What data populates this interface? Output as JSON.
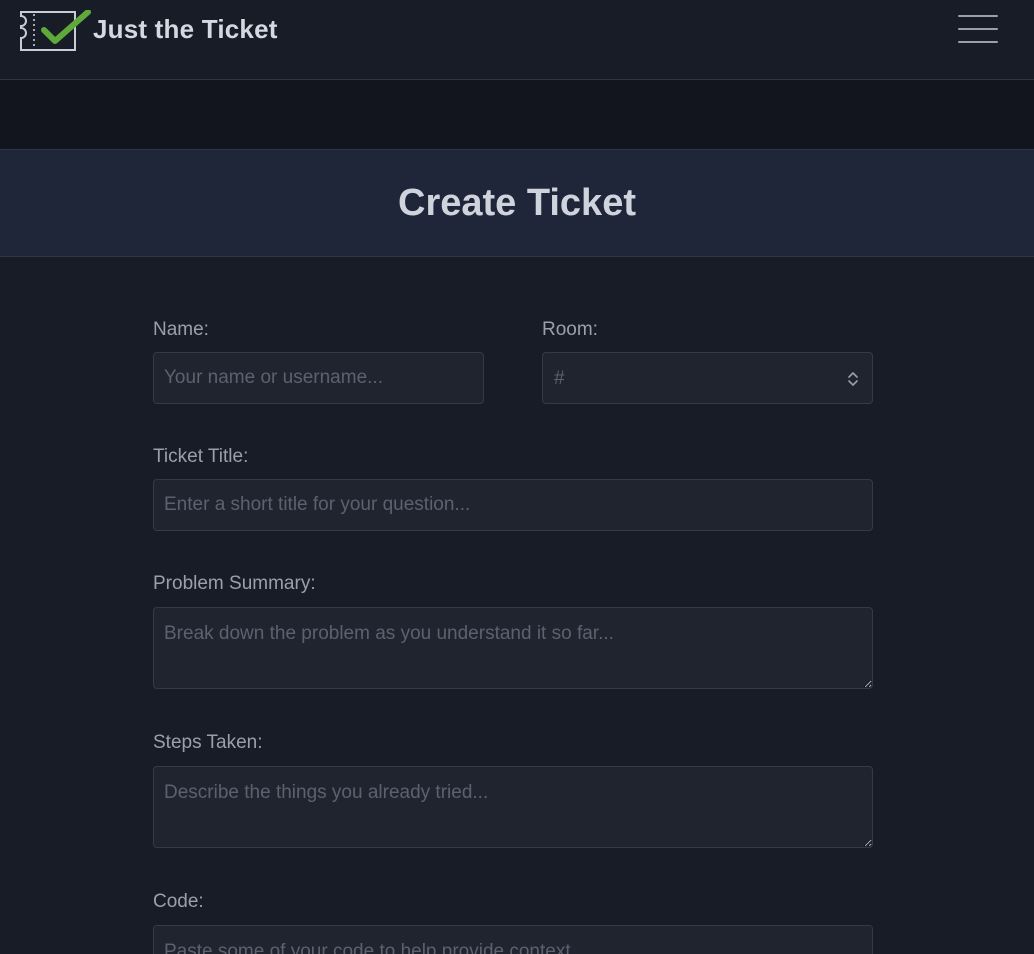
{
  "app": {
    "brand_name": "Just the Ticket",
    "accent": "#5fa83a"
  },
  "header": {
    "title": "Create Ticket"
  },
  "form": {
    "name": {
      "label": "Name:",
      "placeholder": "Your name or username..."
    },
    "room": {
      "label": "Room:",
      "selected": "#"
    },
    "ticket_title": {
      "label": "Ticket Title:",
      "placeholder": "Enter a short title for your question..."
    },
    "problem_summary": {
      "label": "Problem Summary:",
      "placeholder": "Break down the problem as you understand it so far..."
    },
    "steps_taken": {
      "label": "Steps Taken:",
      "placeholder": "Describe the things you already tried..."
    },
    "code": {
      "label": "Code:",
      "placeholder": "Paste some of your code to help provide context..."
    }
  },
  "icons": {
    "logo": "ticket-check-logo",
    "menu": "hamburger-icon",
    "select": "chevron-up-down-icon"
  }
}
